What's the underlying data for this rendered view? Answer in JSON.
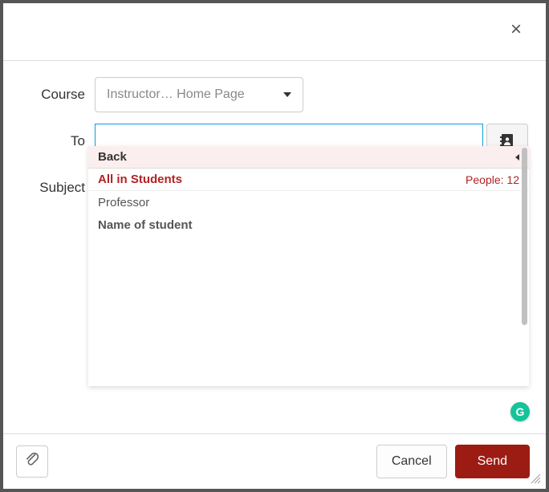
{
  "labels": {
    "course": "Course",
    "to": "To",
    "subject": "Subject"
  },
  "course_select": {
    "text": "Instructor… Home Page"
  },
  "to_value": "",
  "subject_value": "",
  "dropdown": {
    "back": "Back",
    "all_label": "All in Students",
    "people_label": "People: 12",
    "items": [
      "Professor"
    ],
    "name_placeholder": "Name of student"
  },
  "footer": {
    "cancel": "Cancel",
    "send": "Send"
  },
  "grammarly": "G"
}
